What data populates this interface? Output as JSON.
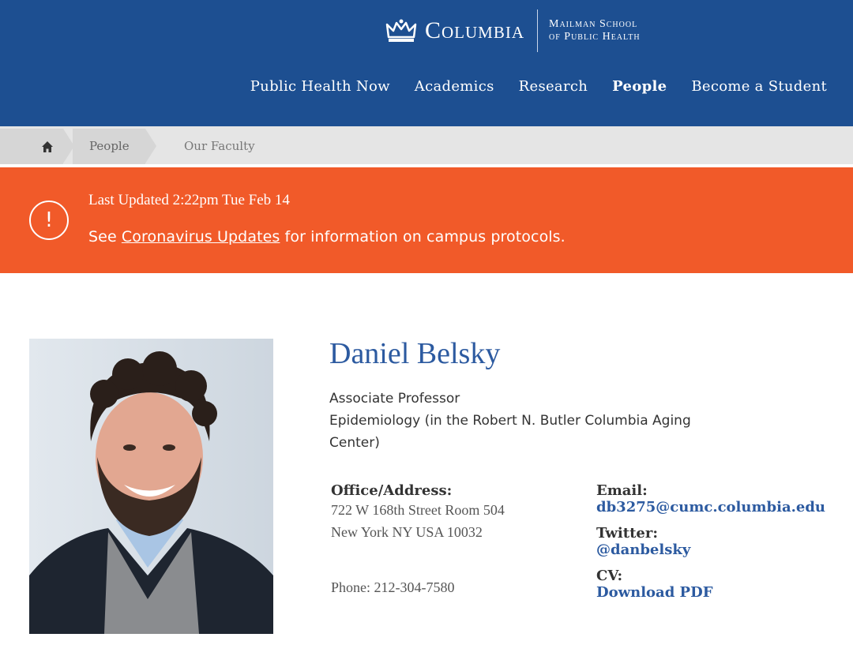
{
  "header": {
    "wordmark": "Columbia",
    "school_line1": "Mailman School",
    "school_line2": "of Public Health",
    "nav": [
      {
        "label": "Public Health Now",
        "active": false
      },
      {
        "label": "Academics",
        "active": false
      },
      {
        "label": "Research",
        "active": false
      },
      {
        "label": "People",
        "active": true
      },
      {
        "label": "Become a Student",
        "active": false
      }
    ]
  },
  "breadcrumb": {
    "home_icon": "home-icon",
    "items": [
      "People",
      "Our Faculty"
    ]
  },
  "alert": {
    "icon": "exclamation-icon",
    "title": "Last Updated 2:22pm Tue Feb 14",
    "body_prefix": "See ",
    "link_text": "Coronavirus Updates",
    "body_suffix": " for information on campus protocols."
  },
  "profile": {
    "name": "Daniel Belsky",
    "position": "Associate Professor",
    "department": "Epidemiology (in the Robert N. Butler Columbia Aging Center)",
    "office_label": "Office/Address:",
    "address_line1": "722 W 168th Street Room 504",
    "address_line2": "New York NY USA 10032",
    "phone": "Phone: 212-304-7580",
    "email_label": "Email:",
    "email": "db3275@cumc.columbia.edu",
    "twitter_label": "Twitter:",
    "twitter": "@danbelsky",
    "cv_label": "CV:",
    "cv_link": "Download PDF"
  },
  "colors": {
    "header_blue": "#1d4f91",
    "alert_orange": "#f15a29",
    "link_blue": "#2c5aa0"
  }
}
